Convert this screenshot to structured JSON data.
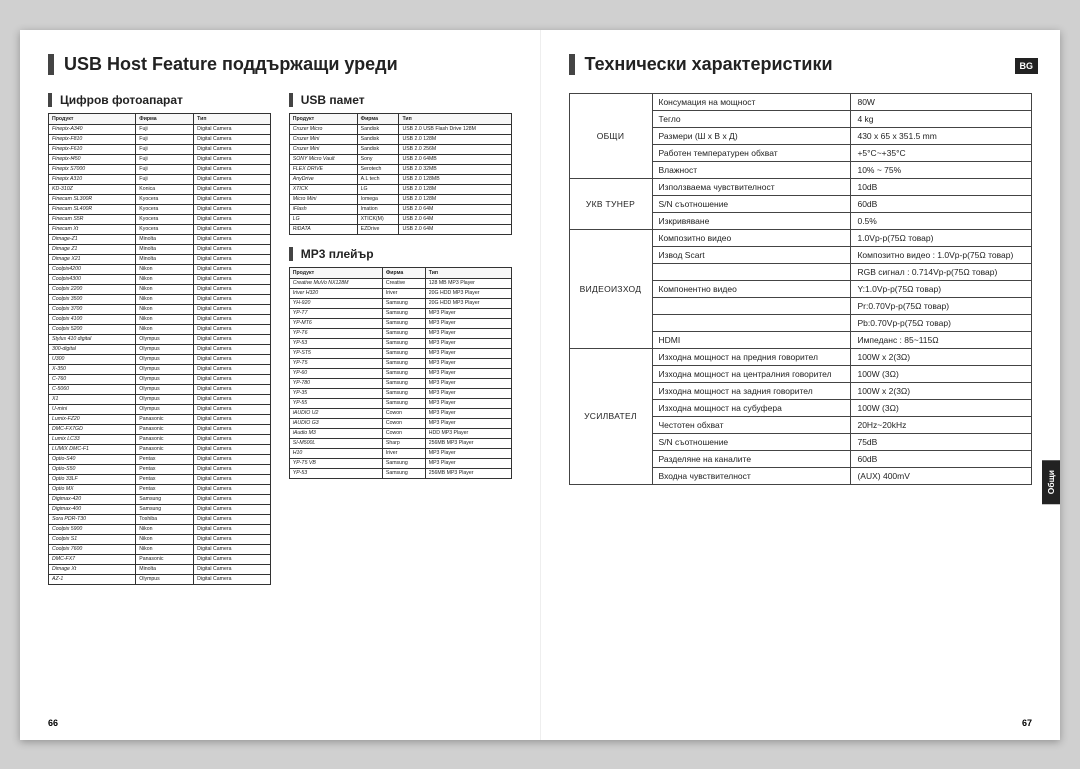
{
  "left": {
    "title": "USB Host Feature поддържащи уреди",
    "pageNum": "66",
    "camera": {
      "heading": "Цифров фотоапарат",
      "headers": [
        "Продукт",
        "Фирма",
        "Тип"
      ],
      "rows": [
        [
          "Finepix-A340",
          "Fuji",
          "Digital Camera"
        ],
        [
          "Finepix-F810",
          "Fuji",
          "Digital Camera"
        ],
        [
          "Finepix-F610",
          "Fuji",
          "Digital Camera"
        ],
        [
          "Finepix-f450",
          "Fuji",
          "Digital Camera"
        ],
        [
          "Finepix S7000",
          "Fuji",
          "Digital Camera"
        ],
        [
          "Finepix A310",
          "Fuji",
          "Digital Camera"
        ],
        [
          "KD-310Z",
          "Konica",
          "Digital Camera"
        ],
        [
          "Finecam SL300R",
          "Kyocera",
          "Digital Camera"
        ],
        [
          "Finecam SL400R",
          "Kyocera",
          "Digital Camera"
        ],
        [
          "Finecam S5R",
          "Kyocera",
          "Digital Camera"
        ],
        [
          "Finecam Xt",
          "Kyocera",
          "Digital Camera"
        ],
        [
          "Dimage-Z1",
          "Minolta",
          "Digital Camera"
        ],
        [
          "Dimage Z1",
          "Minolta",
          "Digital Camera"
        ],
        [
          "Dimage X21",
          "Minolta",
          "Digital Camera"
        ],
        [
          "Coolpix4200",
          "Nikon",
          "Digital Camera"
        ],
        [
          "Coolpix4300",
          "Nikon",
          "Digital Camera"
        ],
        [
          "Coolpix 2200",
          "Nikon",
          "Digital Camera"
        ],
        [
          "Coolpix 3500",
          "Nikon",
          "Digital Camera"
        ],
        [
          "Coolpix 3700",
          "Nikon",
          "Digital Camera"
        ],
        [
          "Coolpix 4100",
          "Nikon",
          "Digital Camera"
        ],
        [
          "Coolpix 5200",
          "Nikon",
          "Digital Camera"
        ],
        [
          "Stylus 410 digital",
          "Olympus",
          "Digital Camera"
        ],
        [
          "300-digital",
          "Olympus",
          "Digital Camera"
        ],
        [
          "U300",
          "Olympus",
          "Digital Camera"
        ],
        [
          "X-350",
          "Olympus",
          "Digital Camera"
        ],
        [
          "C-760",
          "Olympus",
          "Digital Camera"
        ],
        [
          "C-5060",
          "Olympus",
          "Digital Camera"
        ],
        [
          "X1",
          "Olympus",
          "Digital Camera"
        ],
        [
          "U-mini",
          "Olympus",
          "Digital Camera"
        ],
        [
          "Lumix-FZ20",
          "Panasonic",
          "Digital Camera"
        ],
        [
          "DMC-FX7GD",
          "Panasonic",
          "Digital Camera"
        ],
        [
          "Lumix LC33",
          "Panasonic",
          "Digital Camera"
        ],
        [
          "LUMIX DMC-F1",
          "Panasonic",
          "Digital Camera"
        ],
        [
          "Optio-S40",
          "Pentax",
          "Digital Camera"
        ],
        [
          "Optio-S50",
          "Pentax",
          "Digital Camera"
        ],
        [
          "Optio 33LF",
          "Pentax",
          "Digital Camera"
        ],
        [
          "Optio MX",
          "Pentax",
          "Digital Camera"
        ],
        [
          "Digimax-420",
          "Samsung",
          "Digital Camera"
        ],
        [
          "Digimax-400",
          "Samsung",
          "Digital Camera"
        ],
        [
          "Sora PDR-T30",
          "Toshiba",
          "Digital Camera"
        ],
        [
          "Coolpix 5900",
          "Nikon",
          "Digital Camera"
        ],
        [
          "Coolpix S1",
          "Nikon",
          "Digital Camera"
        ],
        [
          "Coolpix 7600",
          "Nikon",
          "Digital Camera"
        ],
        [
          "DMC-FX7",
          "Panasonic",
          "Digital Camera"
        ],
        [
          "Dimage Xt",
          "Minolta",
          "Digital Camera"
        ],
        [
          "AZ-1",
          "Olympus",
          "Digital Camera"
        ]
      ]
    },
    "usb": {
      "heading": "USB памет",
      "headers": [
        "Продукт",
        "Фирма",
        "Тип"
      ],
      "rows": [
        [
          "Cruzer Micro",
          "Sandisk",
          "USB 2.0 USB Flash Drive 128M"
        ],
        [
          "Cruzer Mini",
          "Sandisk",
          "USB 2.0 128M"
        ],
        [
          "Cruzer Mini",
          "Sandisk",
          "USB 2.0 256M"
        ],
        [
          "SONY Micro Vault",
          "Sony",
          "USB 2.0 64MB"
        ],
        [
          "FLEX DRIVE",
          "Serotech",
          "USB 2.0 32MB"
        ],
        [
          "AnyDrive",
          "A.L tech",
          "USB 2.0 128MB"
        ],
        [
          "XTICK",
          "LG",
          "USB 2.0 128M"
        ],
        [
          "Micro Mini",
          "Iomega",
          "USB 2.0 128M"
        ],
        [
          "iFlash",
          "Imation",
          "USB 2.0 64M"
        ],
        [
          "LG",
          "XTICK(M)",
          "USB 2.0 64M"
        ],
        [
          "RiDATA",
          "EZDrive",
          "USB 2.0 64M"
        ]
      ]
    },
    "mp3": {
      "heading": "MP3 плейър",
      "headers": [
        "Продукт",
        "Фирма",
        "Тип"
      ],
      "rows": [
        [
          "Creative MuVo NX128M",
          "Creative",
          "128 MB MP3 Player"
        ],
        [
          "Iriver H320",
          "Iriver",
          "20G HDD MP3 Player"
        ],
        [
          "YH-920",
          "Samsung",
          "20G HDD MP3 Player"
        ],
        [
          "YP-T7",
          "Samsung",
          "MP3 Player"
        ],
        [
          "YP-MT6",
          "Samsung",
          "MP3 Player"
        ],
        [
          "YP-T6",
          "Samsung",
          "MP3 Player"
        ],
        [
          "YP-53",
          "Samsung",
          "MP3 Player"
        ],
        [
          "YP-ST5",
          "Samsung",
          "MP3 Player"
        ],
        [
          "YP-T5",
          "Samsung",
          "MP3 Player"
        ],
        [
          "YP-60",
          "Samsung",
          "MP3 Player"
        ],
        [
          "YP-780",
          "Samsung",
          "MP3 Player"
        ],
        [
          "YP-35",
          "Samsung",
          "MP3 Player"
        ],
        [
          "YP-55",
          "Samsung",
          "MP3 Player"
        ],
        [
          "iAUDIO U2",
          "Cowon",
          "MP3 Player"
        ],
        [
          "iAUDIO G3",
          "Cowon",
          "MP3 Player"
        ],
        [
          "iAudio M3",
          "Cowon",
          "HDD MP3 Player"
        ],
        [
          "SI-M500L",
          "Sharp",
          "256MB MP3 Player"
        ],
        [
          "H10",
          "Iriver",
          "MP3 Player"
        ],
        [
          "YP-T5 VB",
          "Samsung",
          "MP3 Player"
        ],
        [
          "YP-53",
          "Samsung",
          "256MB MP3 Player"
        ]
      ]
    }
  },
  "right": {
    "title": "Технически характеристики",
    "badge": "BG",
    "sideTab": "Общи",
    "pageNum": "67",
    "spec": {
      "groups": [
        {
          "name": "ОБЩИ",
          "rows": [
            [
              "Консумация на мощност",
              "80W"
            ],
            [
              "Тегло",
              "4 kg"
            ],
            [
              "Размери (Ш x В x Д)",
              "430 x 65 x 351.5 mm"
            ],
            [
              "Работен температурен обхват",
              "+5°C~+35°C"
            ],
            [
              "Влажност",
              "10% ~ 75%"
            ]
          ]
        },
        {
          "name": "УКВ ТУНЕР",
          "rows": [
            [
              "Използваема чувствителност",
              "10dB"
            ],
            [
              "S/N съотношение",
              "60dB"
            ],
            [
              "Изкривяване",
              "0.5%"
            ]
          ]
        },
        {
          "name": "ВИДЕОИЗХОД",
          "rows": [
            [
              "Композитно видео",
              "1.0Vp-p(75Ω товар)"
            ],
            [
              "Извод Scart",
              "Композитно видео : 1.0Vp-p(75Ω товар)"
            ],
            [
              "",
              "RGB сигнал : 0.714Vp-p(75Ω товар)"
            ],
            [
              "Компонентно видео",
              "Y:1.0Vp-p(75Ω товар)"
            ],
            [
              "",
              "Pr:0.70Vp-p(75Ω товар)"
            ],
            [
              "",
              "Pb:0.70Vp-p(75Ω товар)"
            ],
            [
              "HDMI",
              "Импеданс : 85~115Ω"
            ]
          ]
        },
        {
          "name": "УСИЛВАТЕЛ",
          "rows": [
            [
              "Изходна мощност на предния говорител",
              "100W x 2(3Ω)"
            ],
            [
              "Изходна мощност на централния говорител",
              "100W (3Ω)"
            ],
            [
              "Изходна мощност на задния говорител",
              "100W x 2(3Ω)"
            ],
            [
              "Изходна мощност на субуфера",
              "100W (3Ω)"
            ],
            [
              "Честотен обхват",
              "20Hz~20kHz"
            ],
            [
              "S/N съотношение",
              "75dB"
            ],
            [
              "Разделяне на каналите",
              "60dB"
            ],
            [
              "Входна чувствителност",
              "(AUX) 400mV"
            ]
          ]
        }
      ]
    }
  }
}
